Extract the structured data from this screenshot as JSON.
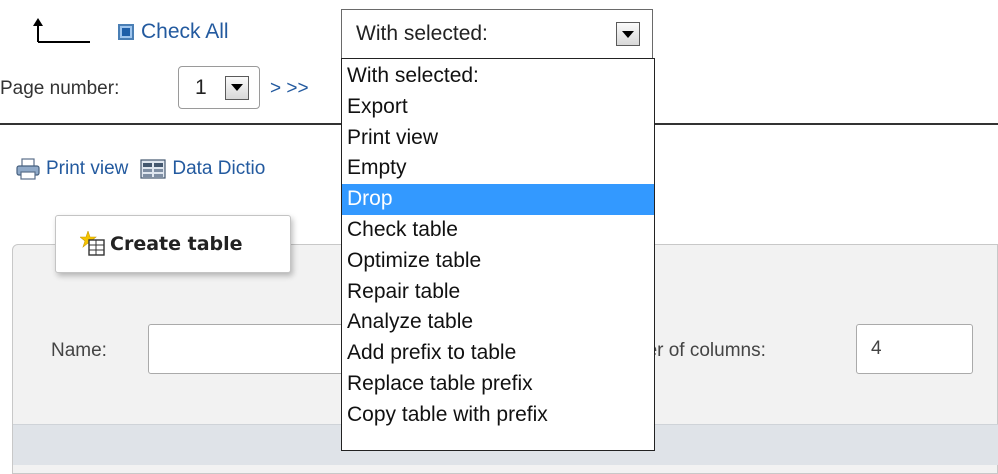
{
  "toolbar": {
    "check_all_label": "Check All",
    "with_selected_value": "With selected:",
    "page_number_label": "Page number:",
    "page_number_value": "1",
    "page_nav": "> >>"
  },
  "links": {
    "print_view": "Print view",
    "data_dictionary": "Data Dictio"
  },
  "dropdown": {
    "options": [
      "With selected:",
      "Export",
      "Print view",
      "Empty",
      "Drop",
      "Check table",
      "Optimize table",
      "Repair table",
      "Analyze table",
      "Add prefix to table",
      "Replace table prefix",
      "Copy table with prefix"
    ],
    "highlighted": "Drop"
  },
  "create_table": {
    "legend": "Create table",
    "name_label": "Name:",
    "name_value": "",
    "columns_label": "ber of columns:",
    "columns_value": "4"
  },
  "colors": {
    "link": "#235a9f",
    "highlight": "#3399ff",
    "fieldset_bg": "#f2f2f2"
  },
  "icons": [
    "arrow-up-icon",
    "checkbox-icon",
    "chevron-down-icon",
    "printer-icon",
    "data-dictionary-icon",
    "create-table-icon"
  ]
}
